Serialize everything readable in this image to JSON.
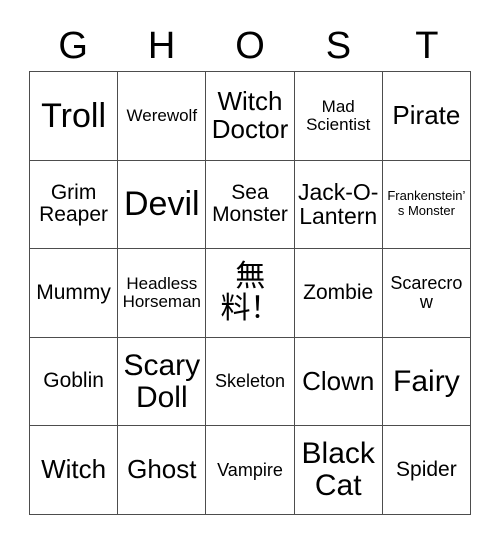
{
  "header": {
    "letters": [
      "G",
      "H",
      "O",
      "S",
      "T"
    ]
  },
  "grid": {
    "rows": 5,
    "columns": 5,
    "border_color": "#4d4d4d",
    "background_color": "#ffffff",
    "text_color": "#000000",
    "cells": [
      {
        "label": "Troll",
        "size": "fs-xxl"
      },
      {
        "label": "Werewolf",
        "size": "fs-sm"
      },
      {
        "label": "Witch Doctor",
        "size": "fs-lg"
      },
      {
        "label": "Mad Scientist",
        "size": "fs-sm"
      },
      {
        "label": "Pirate",
        "size": "fs-lg"
      },
      {
        "label": "Grim Reaper",
        "size": "fs-md"
      },
      {
        "label": "Devil",
        "size": "fs-xxl"
      },
      {
        "label": "Sea Monster",
        "size": "fs-md"
      },
      {
        "label": "Jack-O-Lantern",
        "size": "fs-mdl"
      },
      {
        "label": "Frankenstein’s Monster",
        "size": "fs-xs"
      },
      {
        "label": "Mummy",
        "size": "fs-md"
      },
      {
        "label": "Headless Horseman",
        "size": "fs-sm"
      },
      {
        "label": "無料！",
        "size": "fs-free"
      },
      {
        "label": "Zombie",
        "size": "fs-md"
      },
      {
        "label": "Scarecrow",
        "size": "fs-smm"
      },
      {
        "label": "Goblin",
        "size": "fs-md"
      },
      {
        "label": "Scary Doll",
        "size": "fs-xl"
      },
      {
        "label": "Skeleton",
        "size": "fs-smm"
      },
      {
        "label": "Clown",
        "size": "fs-lg"
      },
      {
        "label": "Fairy",
        "size": "fs-xl"
      },
      {
        "label": "Witch",
        "size": "fs-lg"
      },
      {
        "label": "Ghost",
        "size": "fs-lg"
      },
      {
        "label": "Vampire",
        "size": "fs-smm"
      },
      {
        "label": "Black Cat",
        "size": "fs-xl"
      },
      {
        "label": "Spider",
        "size": "fs-md"
      }
    ]
  }
}
